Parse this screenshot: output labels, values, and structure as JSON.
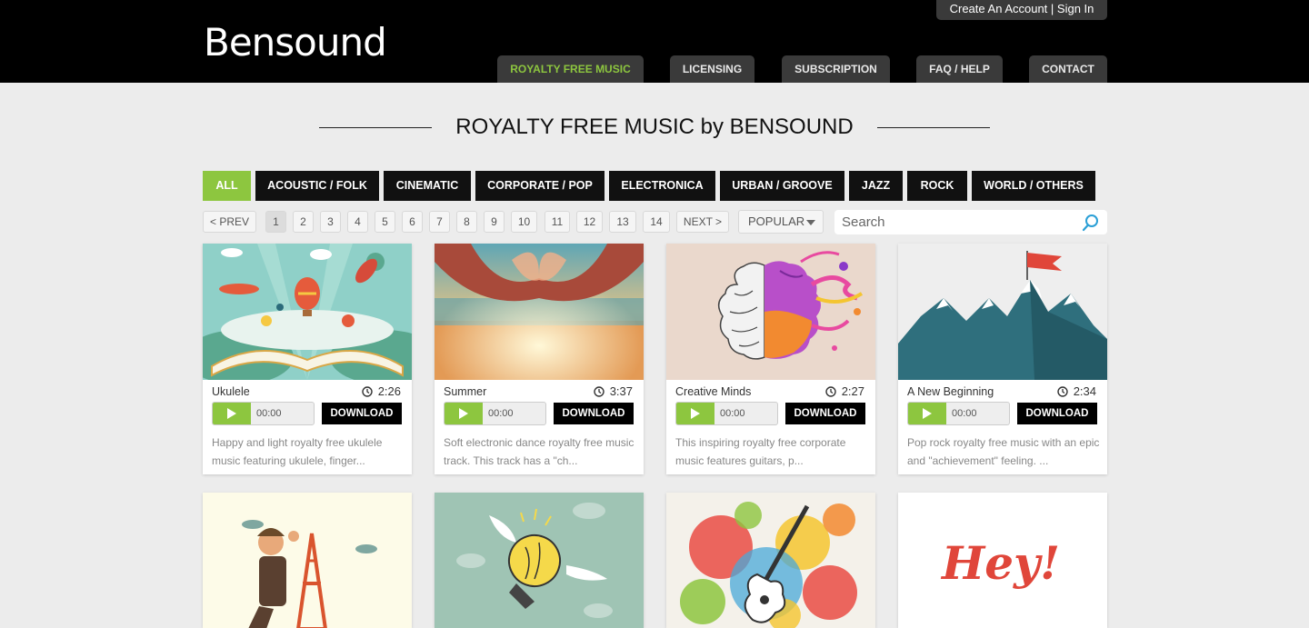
{
  "header": {
    "logo": "Bensound",
    "account_create": "Create An Account",
    "account_sep": " | ",
    "account_signin": "Sign In",
    "nav": [
      "ROYALTY FREE MUSIC",
      "LICENSING",
      "SUBSCRIPTION",
      "FAQ / HELP",
      "CONTACT"
    ],
    "active_nav": "ROYALTY FREE MUSIC",
    "accent_color": "#8dc63f"
  },
  "page_title": "ROYALTY FREE MUSIC by BENSOUND",
  "categories": [
    "ALL",
    "ACOUSTIC / FOLK",
    "CINEMATIC",
    "CORPORATE / POP",
    "ELECTRONICA",
    "URBAN / GROOVE",
    "JAZZ",
    "ROCK",
    "WORLD / OTHERS"
  ],
  "active_category": "ALL",
  "pagination": {
    "prev": "< PREV",
    "pages": [
      "1",
      "2",
      "3",
      "4",
      "5",
      "6",
      "7",
      "8",
      "9",
      "10",
      "11",
      "12",
      "13",
      "14"
    ],
    "current": "1",
    "next": "NEXT >",
    "sort": "POPULAR"
  },
  "search": {
    "placeholder": "Search"
  },
  "tracks": [
    {
      "title": "Ukulele",
      "duration": "2:26",
      "time": "00:00",
      "download": "DOWNLOAD",
      "description": "Happy and light royalty free ukulele music featuring ukulele, finger..."
    },
    {
      "title": "Summer",
      "duration": "3:37",
      "time": "00:00",
      "download": "DOWNLOAD",
      "description": "Soft electronic dance royalty free music track. This track has a \"ch..."
    },
    {
      "title": "Creative Minds",
      "duration": "2:27",
      "time": "00:00",
      "download": "DOWNLOAD",
      "description": "This inspiring royalty free corporate music features guitars, p..."
    },
    {
      "title": "A New Beginning",
      "duration": "2:34",
      "time": "00:00",
      "download": "DOWNLOAD",
      "description": "Pop rock royalty free music with an epic and \"achievement\" feeling. ..."
    }
  ],
  "second_row_art": {
    "hey_text": "Hey!"
  }
}
